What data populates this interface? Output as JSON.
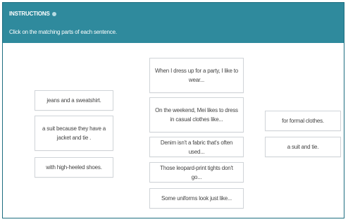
{
  "header": {
    "title": "INSTRUCTIONS",
    "instruction": "Click on the matching parts of each sentence."
  },
  "columns": {
    "left": [
      "jeans and a sweatshirt.",
      "a suit because they have a jacket and tie .",
      "with high-heeled shoes."
    ],
    "middle": [
      "When I dress up for a party, I like to wear...",
      "On the weekend, Mei likes to dress in casual clothes like...",
      "Denim isn't a fabric that's often used...",
      "Those leopard-print tights don't go...",
      "Some uniforms look just like..."
    ],
    "right": [
      "for formal clothes.",
      "a suit and tie."
    ]
  },
  "colors": {
    "header_bg": "#2f8a9d",
    "card_border": "#d0d4d8",
    "frame_border": "#1e6e80"
  },
  "icons": {
    "title_icon": "info-dot-icon"
  }
}
